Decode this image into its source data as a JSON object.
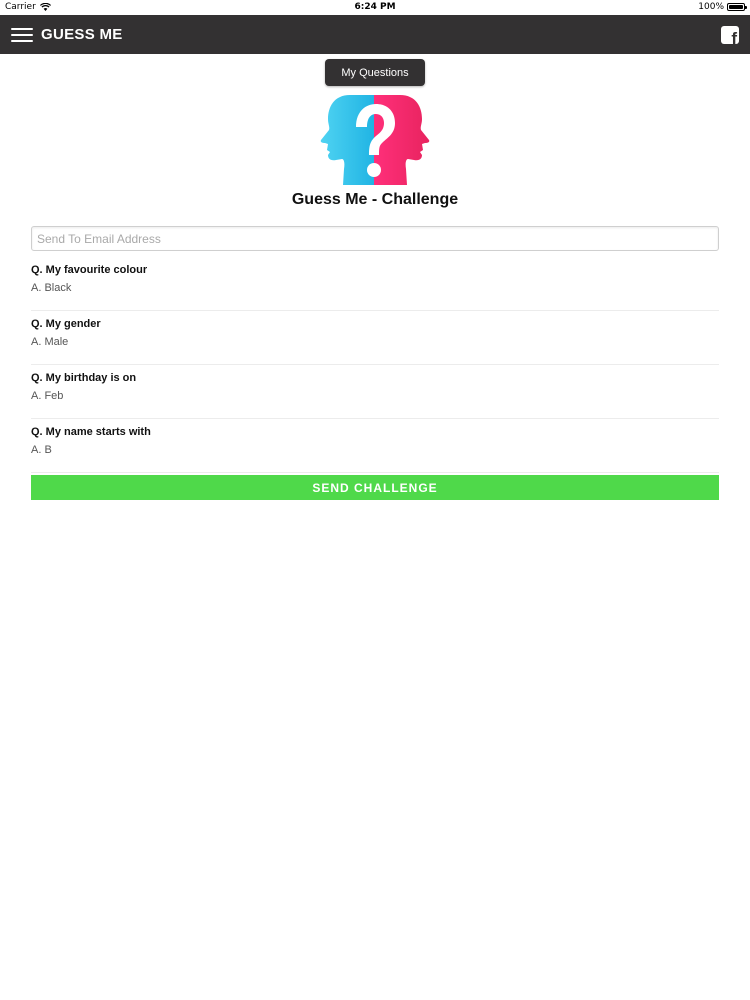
{
  "status_bar": {
    "carrier": "Carrier",
    "time": "6:24 PM",
    "battery": "100%",
    "battery_level": 1.0
  },
  "navbar": {
    "title": "GUESS ME",
    "menu_icon": "hamburger-menu-icon",
    "facebook_icon": "facebook-icon",
    "background": "#333132"
  },
  "my_questions_label": "My Questions",
  "logo_icon": "question-mark-faces-logo",
  "page_title": "Guess Me - Challenge",
  "email": {
    "placeholder": "Send To Email Address",
    "value": ""
  },
  "questions": [
    {
      "q": "Q. My favourite colour",
      "a": "A. Black"
    },
    {
      "q": "Q. My gender",
      "a": "A. Male"
    },
    {
      "q": "Q. My birthday is on",
      "a": "A. Feb"
    },
    {
      "q": "Q. My name starts with",
      "a": "A. B"
    }
  ],
  "send_label": "SEND CHALLENGE",
  "colors": {
    "accent_green": "#4fd94a",
    "logo_blue": "#29c0e8",
    "logo_pink": "#f0306e"
  }
}
